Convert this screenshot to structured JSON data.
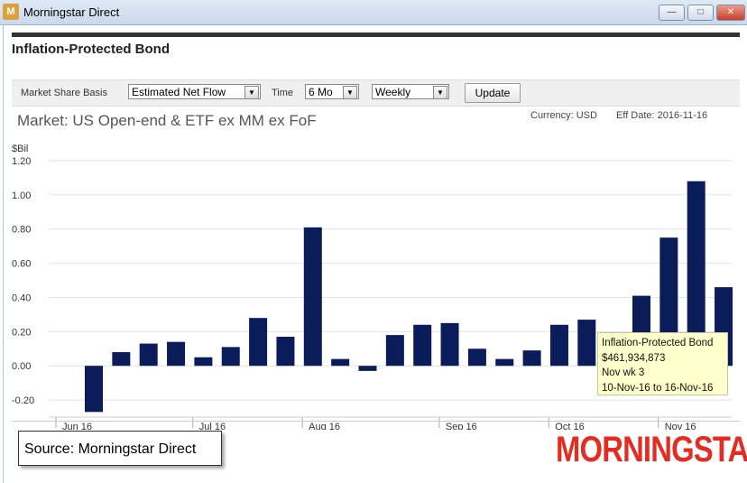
{
  "window": {
    "title": "Morningstar Direct",
    "icon_label": "M"
  },
  "page": {
    "title": "Inflation-Protected Bond"
  },
  "toolbar": {
    "basis_label": "Market Share Basis",
    "basis_value": "Estimated Net Flow",
    "time_label": "Time",
    "time_value": "6 Mo",
    "freq_value": "Weekly",
    "update_label": "Update"
  },
  "market": {
    "title": "Market: US Open-end & ETF ex MM ex FoF",
    "currency": "Currency: USD",
    "eff_date": "Eff Date: 2016-11-16"
  },
  "tooltip": {
    "line1": "Inflation-Protected Bond",
    "line2": "$461,934,873",
    "line3": "Nov wk 3",
    "line4": "10-Nov-16 to 16-Nov-16"
  },
  "source": "Source: Morningstar Direct",
  "logo": {
    "text": "MORNINGSTAR",
    "reg": "®"
  },
  "colors": {
    "bar": "#0b1c5a",
    "grid": "#e2e2e2",
    "tooltip_bg": "#ffffcc",
    "logo": "#e32d23"
  },
  "chart_data": {
    "type": "bar",
    "ylabel": "$Bil",
    "ylim": [
      -0.3,
      1.2
    ],
    "yticks": [
      "1.20",
      "1.00",
      "0.80",
      "0.60",
      "0.40",
      "0.20",
      "0.00",
      "-0.20"
    ],
    "ytick_values": [
      1.2,
      1.0,
      0.8,
      0.6,
      0.4,
      0.2,
      0.0,
      -0.2
    ],
    "month_labels": [
      "Jun 16",
      "Jul 16",
      "Aug 16",
      "Sep 16",
      "Oct 16",
      "Nov 16"
    ],
    "month_start_index": [
      0,
      5,
      9,
      14,
      18,
      22
    ],
    "values": [
      -0.27,
      0.08,
      0.13,
      0.14,
      0.05,
      0.11,
      0.28,
      0.17,
      0.81,
      0.04,
      -0.03,
      0.18,
      0.24,
      0.25,
      0.1,
      0.04,
      0.09,
      0.24,
      0.27,
      0.12,
      0.41,
      0.75,
      1.08,
      0.46
    ],
    "grid": true
  }
}
